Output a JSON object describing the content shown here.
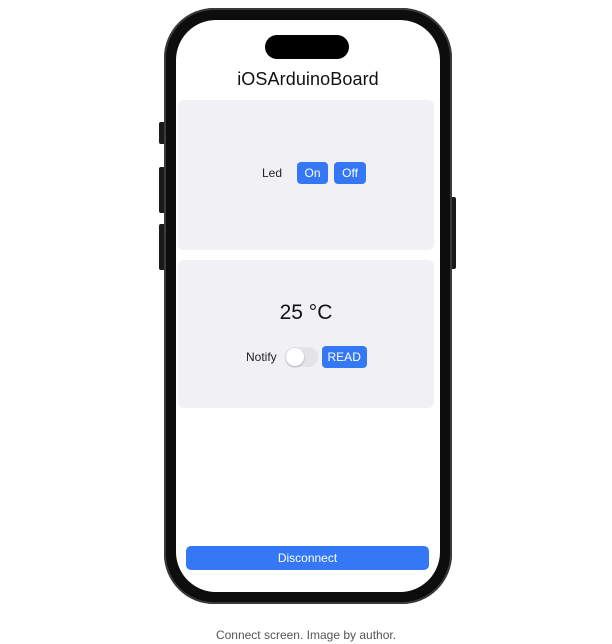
{
  "app": {
    "title": "iOSArduinoBoard"
  },
  "led_panel": {
    "label": "Led",
    "on_label": "On",
    "off_label": "Off"
  },
  "temperature_panel": {
    "value": "25 °C",
    "notify_label": "Notify",
    "notify_enabled": false,
    "read_label": "READ"
  },
  "footer": {
    "disconnect_label": "Disconnect"
  },
  "caption": "Connect screen. Image by author.",
  "colors": {
    "accent": "#3478f6",
    "card_background": "#f1f1f5",
    "phone_frame": "#0d0d0d"
  },
  "icons": {
    "notify_toggle": "toggle-switch-icon"
  }
}
